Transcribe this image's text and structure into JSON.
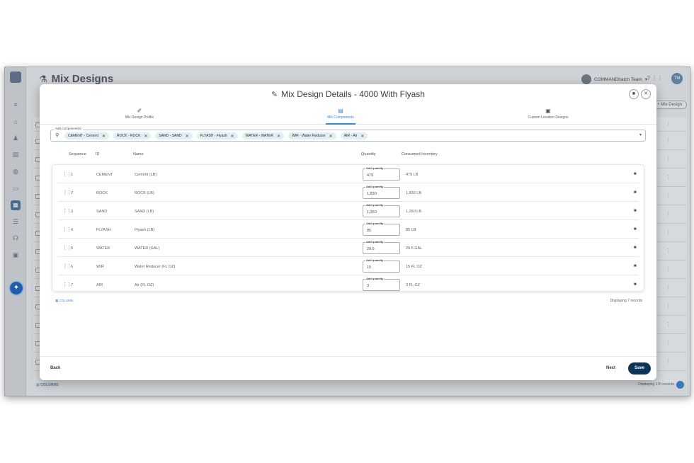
{
  "app": {
    "title": "Mix Designs",
    "team": "COMMANDbatch Team",
    "avatar_initials": "TM",
    "add_button": "+ Mix Design",
    "columns_link": "COLUMNS",
    "record_count": "Displaying 170 records"
  },
  "modal": {
    "title": "Mix Design Details - 4000 With Flyash",
    "steps": [
      {
        "label": "Mix Design Profile",
        "icon": "pen-icon"
      },
      {
        "label": "Mix Components",
        "icon": "grid-icon"
      },
      {
        "label": "Custom Location Designs",
        "icon": "calendar-icon"
      }
    ],
    "components_label": "Add component(s)",
    "chips": [
      "CEMENT - Cement",
      "ROCK - ROCK",
      "SAND - SAND",
      "FLYASH - Flyash",
      "WATER - WATER",
      "W/R - Water Reducer",
      "AIR - Air"
    ],
    "headers": {
      "sequence": "Sequence",
      "id": "ID",
      "name": "Name",
      "quantity": "Quantity",
      "consumed": "Consumed Inventory"
    },
    "quantity_label": "Add quantity",
    "rows": [
      {
        "seq": "1",
        "id": "CEMENT",
        "name": "Cement (LB)",
        "qty": "479",
        "consumed": "479 LB"
      },
      {
        "seq": "2",
        "id": "ROCK",
        "name": "ROCK (LB)",
        "qty": "1,830",
        "consumed": "1,830 LB"
      },
      {
        "seq": "3",
        "id": "SAND",
        "name": "SAND (LB)",
        "qty": "1,260",
        "consumed": "1,260 LB"
      },
      {
        "seq": "4",
        "id": "FLYASH",
        "name": "Flyash (LB)",
        "qty": "85",
        "consumed": "85 LB"
      },
      {
        "seq": "5",
        "id": "WATER",
        "name": "WATER (GAL)",
        "qty": "29.5",
        "consumed": "29.5 GAL"
      },
      {
        "seq": "6",
        "id": "W/R",
        "name": "Water Reducer (FL OZ)",
        "qty": "15",
        "consumed": "15 FL OZ"
      },
      {
        "seq": "7",
        "id": "AIR",
        "name": "Air (FL OZ)",
        "qty": "3",
        "consumed": "3 FL OZ"
      }
    ],
    "columns_link": "COLUMN",
    "record_count": "Displaying 7 records",
    "back": "Back",
    "next": "Next",
    "save": "Save"
  }
}
